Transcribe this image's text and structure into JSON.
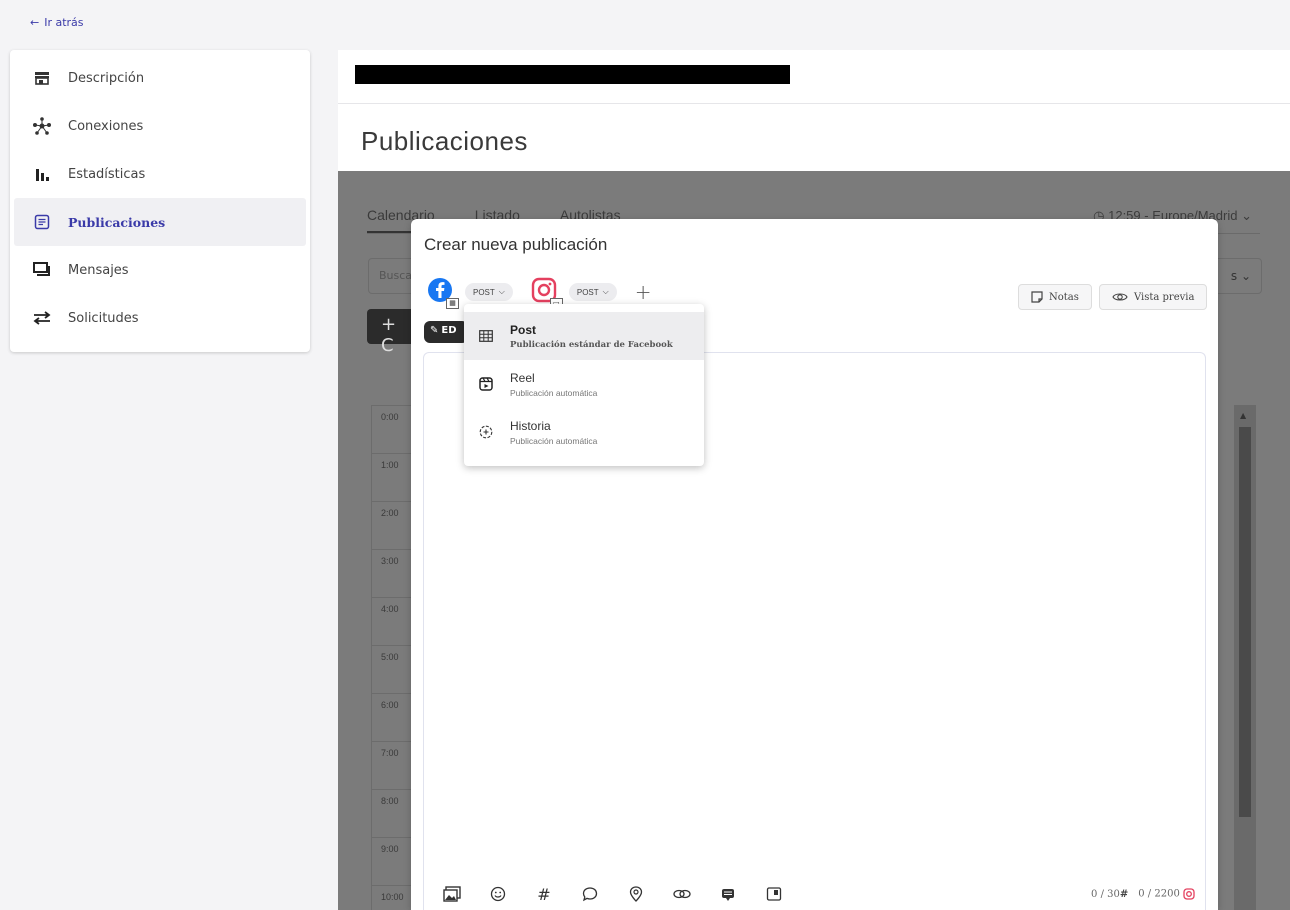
{
  "back": {
    "label": "Ir atrás"
  },
  "sidebar": {
    "items": [
      {
        "label": "Descripción",
        "icon": "store-icon"
      },
      {
        "label": "Conexiones",
        "icon": "network-icon"
      },
      {
        "label": "Estadísticas",
        "icon": "bar-chart-icon"
      },
      {
        "label": "Publicaciones",
        "icon": "document-icon",
        "active": true
      },
      {
        "label": "Mensajes",
        "icon": "chat-icon"
      },
      {
        "label": "Solicitudes",
        "icon": "swap-icon"
      }
    ]
  },
  "main": {
    "page_title": "Publicaciones",
    "tabs": [
      {
        "label": "Calendario"
      },
      {
        "label": "Listado"
      },
      {
        "label": "Autolistas"
      }
    ],
    "timezone": "12:59 - Europe/Madrid",
    "search_placeholder": "Busca",
    "right_dropdown": "s",
    "create_button": "+ C",
    "hours": [
      "0:00",
      "1:00",
      "2:00",
      "3:00",
      "4:00",
      "5:00",
      "6:00",
      "7:00",
      "8:00",
      "9:00",
      "10:00"
    ]
  },
  "modal": {
    "title": "Crear nueva publicación",
    "facebook_type": "POST",
    "instagram_type": "POST",
    "notes_label": "Notas",
    "preview_label": "Vista previa",
    "edit_label": "ED",
    "counter_hashtags": "0 / 30",
    "counter_chars": "0 / 2200"
  },
  "dropdown": {
    "items": [
      {
        "title": "Post",
        "subtitle": "Publicación estándar de Facebook",
        "active": true
      },
      {
        "title": "Reel",
        "subtitle": "Publicación automática"
      },
      {
        "title": "Historia",
        "subtitle": "Publicación automática"
      }
    ]
  },
  "colors": {
    "accent": "#3a3aa8",
    "facebook": "#1877f2",
    "instagram": "#e4405f"
  }
}
